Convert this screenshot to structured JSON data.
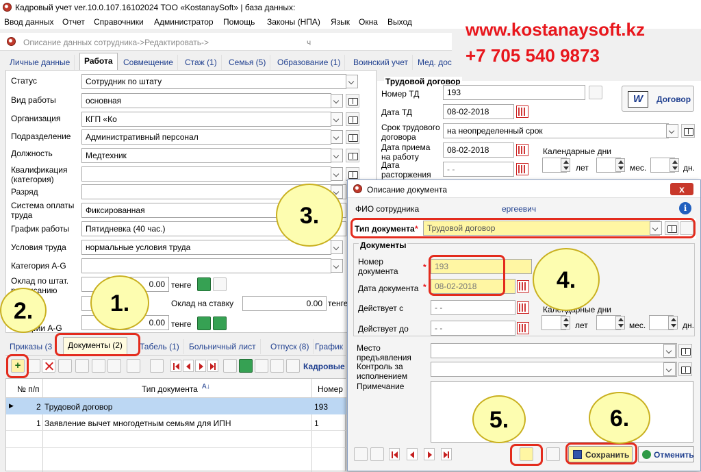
{
  "app": {
    "title": "Кадровый учет ver.10.0.107.16102024 ТОО «KostanaySoft» | база данных:",
    "menu": [
      "Ввод данных",
      "Отчет",
      "Справочники",
      "Администратор",
      "Помощь",
      "Законы (НПА)",
      "Язык",
      "Окна",
      "Выход"
    ]
  },
  "ad": {
    "url": "www.kostanaysoft.kz",
    "phone": "+7 705 540 9873"
  },
  "breadcrumb": {
    "text": "Описание данных сотрудника->Редактировать->",
    "tail": "ч"
  },
  "tabs_top": [
    "Личные данные",
    "Работа",
    "Совмещение",
    "Стаж (1)",
    "Семья (5)",
    "Образование (1)",
    "Воинский учет",
    "Мед. дос"
  ],
  "work_form": {
    "status": {
      "label": "Статус",
      "value": "Сотрудник по штату"
    },
    "work_type": {
      "label": "Вид работы",
      "value": "основная"
    },
    "organization": {
      "label": "Организация",
      "value": "КГП «Ко"
    },
    "department": {
      "label": "Подразделение",
      "value": "Административный персонал"
    },
    "position": {
      "label": "Должность",
      "value": "Медтехник"
    },
    "qualification": {
      "label": "Квалификация\n(категория)",
      "value": ""
    },
    "grade": {
      "label": "Разряд",
      "value": ""
    },
    "pay_system": {
      "label": "Система оплаты\nтруда",
      "value": "Фиксированная"
    },
    "schedule": {
      "label": "График работы",
      "value": "Пятидневка (40 час.)"
    },
    "conditions": {
      "label": "Условия труда",
      "value": "нормальные условия труда"
    },
    "category_ag": {
      "label": "Категория A-G",
      "value": ""
    },
    "salary": {
      "label": "Оклад по штат.\nрасписанию",
      "value": "0.00",
      "currency": "тенге"
    },
    "rate_salary": {
      "label": "Оклад на ставку",
      "value": "0.00",
      "currency": "тенге"
    },
    "ag_salary": {
      "label": "рии A-G",
      "value": "0.00",
      "currency": "тенге"
    }
  },
  "contract": {
    "section_title": "Трудовой договор",
    "number": {
      "label": "Номер ТД",
      "value": "193"
    },
    "date": {
      "label": "Дата ТД",
      "value": "08-02-2018"
    },
    "term": {
      "label": "Срок трудового\nдоговора",
      "value": "на неопределенный срок"
    },
    "hire_date": {
      "label": "Дата приема\nна работу",
      "value": "08-02-2018"
    },
    "end_date": {
      "label": "Дата\nрасторжения",
      "value": "- -"
    },
    "calendar_days": "Календарные дни",
    "units": {
      "years": "лет",
      "months": "мес.",
      "days": "дн."
    },
    "button": "Договор"
  },
  "tabs_bottom": [
    "Приказы (3",
    "Документы (2)",
    "Табель (1)",
    "Больничный лист",
    "Отпуск (8)",
    "График"
  ],
  "bottom_toolbar_label": "Кадровые",
  "documents_table": {
    "columns": [
      "№ п/п",
      "Тип документа",
      "Номер"
    ],
    "rows": [
      {
        "num": "2",
        "type": "Трудовой договор",
        "number": "193",
        "selected": true
      },
      {
        "num": "1",
        "type": "Заявление вычет многодетным семьям для ИПН",
        "number": "1",
        "selected": false
      }
    ]
  },
  "dialog": {
    "title": "Описание документа",
    "close": "x",
    "employee_label": "ФИО сотрудника",
    "employee_value": "ергеевич",
    "doc_type": {
      "label": "Тип документа",
      "required": "*",
      "value": "Трудовой договор"
    },
    "section": "Документы",
    "doc_number": {
      "label": "Номер\nдокумента",
      "required": "*",
      "value": "193"
    },
    "doc_date": {
      "label": "Дата документа",
      "required": "*",
      "value": "08-02-2018"
    },
    "valid_from": {
      "label": "Действует с",
      "value": "- -"
    },
    "valid_to": {
      "label": "Действует до",
      "value": "- -"
    },
    "calendar_days": "Календарные дни",
    "units": {
      "years": "лет",
      "months": "мес.",
      "days": "дн."
    },
    "place": {
      "label": "Место\nпредъявления",
      "value": ""
    },
    "control": {
      "label": "Контроль за\nисполнением",
      "value": ""
    },
    "note": {
      "label": "Примечание",
      "value": ""
    },
    "save": "Сохранить",
    "cancel": "Отменить"
  },
  "callouts": [
    "1.",
    "2.",
    "3.",
    "4.",
    "5.",
    "6."
  ],
  "colors": {
    "accent_red": "#e8161c",
    "callout_fill": "#fdfdb0",
    "selection_blue": "#bcd7f3",
    "link_blue": "#1f3f8f"
  }
}
